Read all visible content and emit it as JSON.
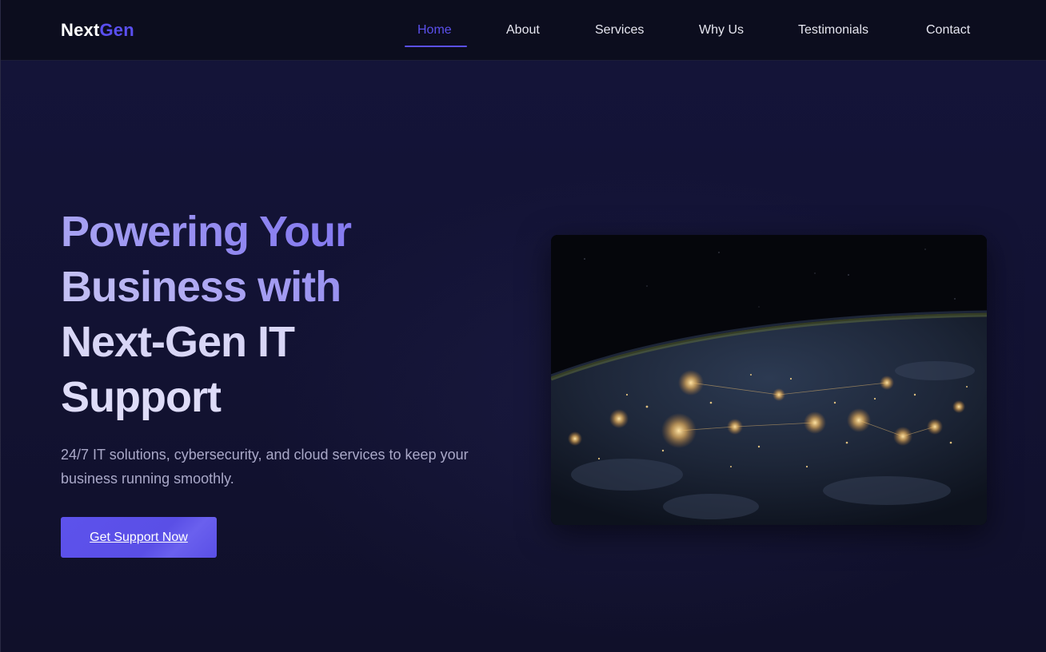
{
  "brand": {
    "logo_part1": "Next",
    "logo_part2": "Gen",
    "accent_color": "#5b50ec"
  },
  "nav": {
    "items": [
      {
        "label": "Home",
        "active": true
      },
      {
        "label": "About",
        "active": false
      },
      {
        "label": "Services",
        "active": false
      },
      {
        "label": "Why Us",
        "active": false
      },
      {
        "label": "Testimonials",
        "active": false
      },
      {
        "label": "Contact",
        "active": false
      }
    ]
  },
  "hero": {
    "title_lines": [
      "Powering Your",
      "Business with",
      "Next-Gen IT",
      "Support"
    ],
    "subtitle": "24/7 IT solutions, cybersecurity, and cloud services to keep your business running smoothly.",
    "cta_label": "Get Support Now",
    "image_subject": "earth-at-night-from-space"
  }
}
